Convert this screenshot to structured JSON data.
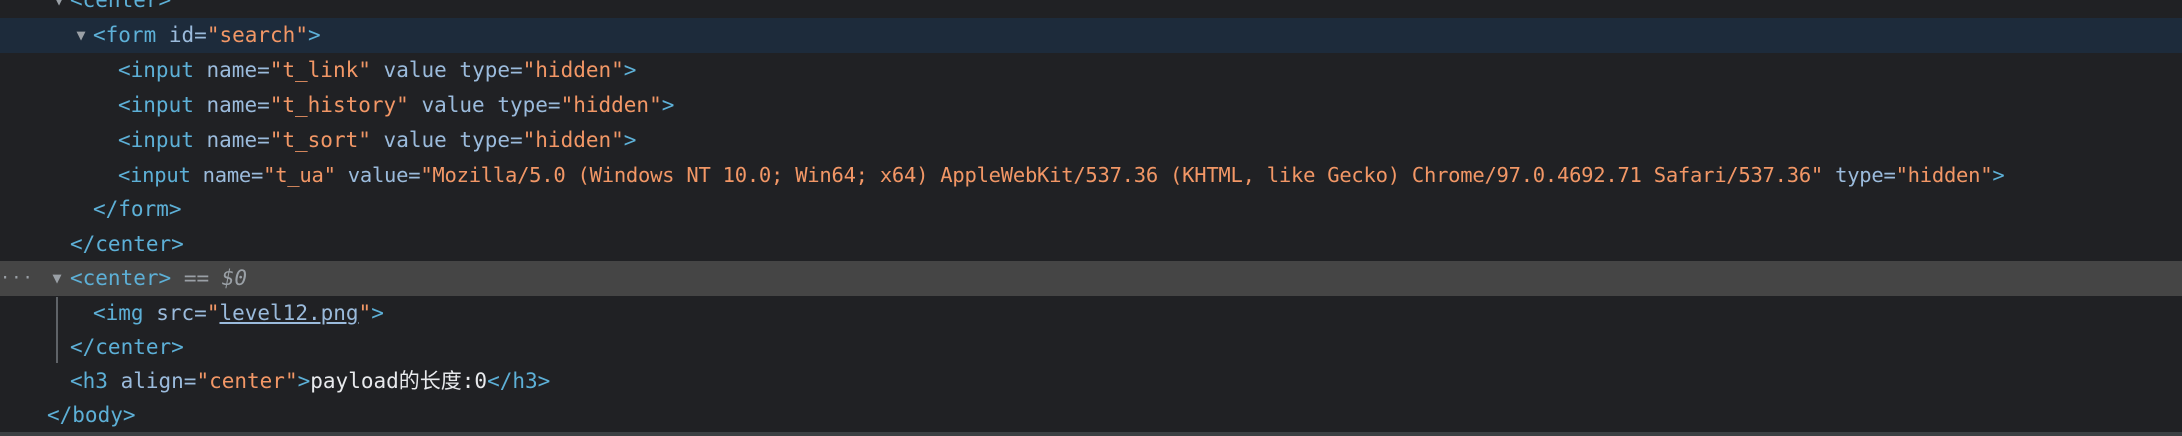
{
  "colors": {
    "background": "#202124",
    "tag": "#5db0d7",
    "attribute_name": "#9bbbdc",
    "attribute_value": "#f29766",
    "text": "#e8eaed",
    "selected_row": "#454545",
    "hovered_row": "#1d2b3b"
  },
  "icons": {
    "expanded": "triangle-down-icon",
    "more_actions": "ellipsis-icon"
  },
  "rows": {
    "center_open_partial": {
      "tag": "<center>"
    },
    "form_open": {
      "tag_open": "<form",
      "attr_id": "id=",
      "id_value": "\"search\"",
      "tag_close": ">"
    },
    "input_link": {
      "tag_open": "<input",
      "attr_name": "name=",
      "name_value": "\"t_link\"",
      "attr_value": "value",
      "attr_type": "type=",
      "type_value": "\"hidden\"",
      "tag_close": ">"
    },
    "input_history": {
      "tag_open": "<input",
      "attr_name": "name=",
      "name_value": "\"t_history\"",
      "attr_value": "value",
      "attr_type": "type=",
      "type_value": "\"hidden\"",
      "tag_close": ">"
    },
    "input_sort": {
      "tag_open": "<input",
      "attr_name": "name=",
      "name_value": "\"t_sort\"",
      "attr_value": "value",
      "attr_type": "type=",
      "type_value": "\"hidden\"",
      "tag_close": ">"
    },
    "input_ua": {
      "tag_open": "<input",
      "attr_name": "name=",
      "name_value": "\"t_ua\"",
      "attr_value": "value=",
      "value_value": "\"Mozilla/5.0 (Windows NT 10.0; Win64; x64) AppleWebKit/537.36 (KHTML, like Gecko) Chrome/97.0.4692.71 Safari/537.36\"",
      "attr_type": "type=",
      "type_value": "\"hidden\"",
      "tag_close": ">"
    },
    "form_close": {
      "tag": "</form>"
    },
    "center_close_1": {
      "tag": "</center>"
    },
    "center_selected": {
      "tag": "<center>",
      "console_ref": "== $0",
      "ellipsis": "···"
    },
    "img": {
      "tag_open": "<img",
      "attr_src": "src=",
      "quote_open": "\"",
      "src_value": "level12.png",
      "quote_close": "\"",
      "tag_close": ">"
    },
    "center_close_2": {
      "tag": "</center>"
    },
    "h3": {
      "tag_open": "<h3",
      "attr_align": "align=",
      "align_value": "\"center\"",
      "tag_gt": ">",
      "text": "payload的长度:0",
      "tag_close": "</h3>"
    },
    "body_close": {
      "tag": "</body>"
    }
  }
}
